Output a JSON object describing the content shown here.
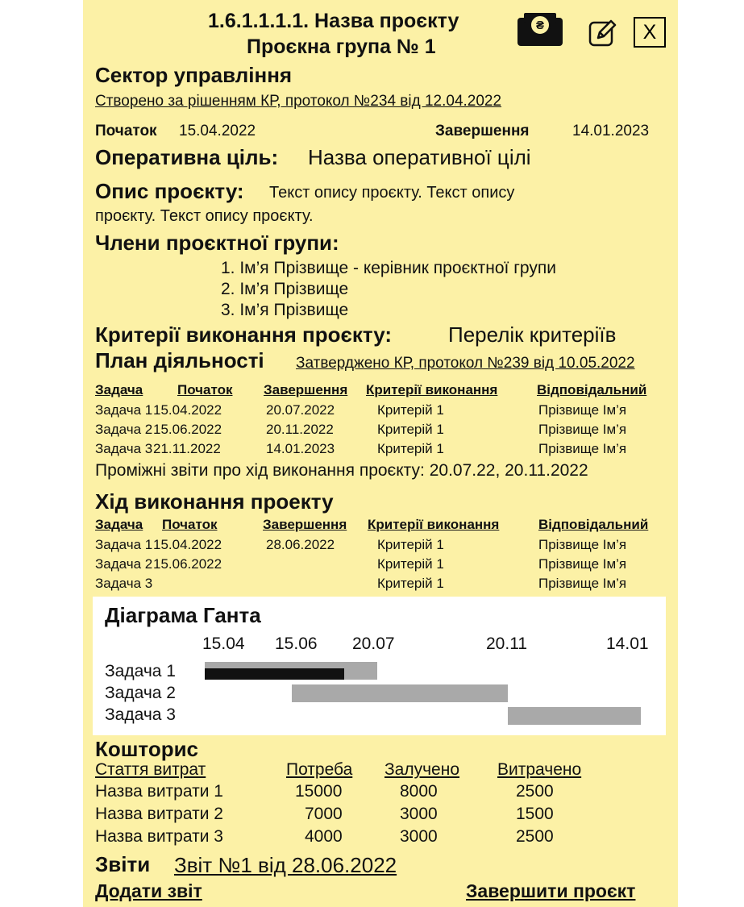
{
  "header": {
    "title": "1.6.1.1.1.1. Назва проєкту",
    "group": "Проєкна група № 1"
  },
  "sector": "Сектор управління",
  "created_note": "Створено за рішенням КР, протокол №234 від 12.04.2022",
  "dates": {
    "start_label": "Початок",
    "start_value": "15.04.2022",
    "end_label": "Завершення",
    "end_value": "14.01.2023"
  },
  "goal": {
    "label": "Оперативна ціль:",
    "value": "Назва оперативної цілі"
  },
  "description": {
    "label": "Опис проєкту:",
    "line1": "Текст опису проєкту. Текст опису",
    "line2": "проєкту. Текст опису проєкту."
  },
  "members": {
    "label": "Члени проєктної групи:",
    "items": [
      "1. Ім’я Прізвище - керівник проєктної групи",
      "2. Ім’я Прізвище",
      "3. Ім’я Прізвище"
    ]
  },
  "criteria": {
    "label": "Критерії виконання проєкту:",
    "value": "Перелік критеріїв"
  },
  "plan": {
    "label": "План діяльності",
    "approval": "Затверджено КР, протокол №239 від 10.05.2022",
    "headers": [
      "Задача",
      "Початок",
      "Завершення",
      "Критерії виконання",
      "Відповідальний"
    ],
    "rows": [
      [
        "Задача 1",
        "15.04.2022",
        "20.07.2022",
        "Критерій 1",
        "Прізвище Ім’я"
      ],
      [
        "Задача 2",
        "15.06.2022",
        "20.11.2022",
        "Критерій 1",
        "Прізвище Ім’я"
      ],
      [
        "Задача 3",
        "21.11.2022",
        "14.01.2023",
        "Критерій 1",
        "Прізвище Ім’я"
      ]
    ],
    "interim_reports": "Проміжні звіти про хід виконання проєкту: 20.07.22, 20.11.2022"
  },
  "progress": {
    "label": "Хід виконання проекту",
    "headers": [
      "Задача",
      "Початок",
      "Завершення",
      "Критерії виконання",
      "Відповідальний"
    ],
    "rows": [
      [
        "Задача 1",
        "15.04.2022",
        "28.06.2022",
        "Критерій 1",
        "Прізвище Ім’я"
      ],
      [
        "Задача 2",
        "15.06.2022",
        "",
        "Критерій 1",
        "Прізвище Ім’я"
      ],
      [
        "Задача 3",
        "",
        "",
        "Критерій 1",
        "Прізвище Ім’я"
      ]
    ]
  },
  "gantt": {
    "title": "Діаграма Ганта",
    "dates": [
      "15.04",
      "15.06",
      "20.07",
      "20.11",
      "14.01"
    ],
    "tasks": [
      "Задача 1",
      "Задача 2",
      "Задача 3"
    ],
    "colors": {
      "planned": "#a9a9a9",
      "actual": "#111111"
    }
  },
  "budget": {
    "label": "Кошторис",
    "headers": [
      "Стаття витрат",
      "Потреба",
      "Залучено",
      "Витрачено"
    ],
    "rows": [
      [
        "Назва витрати 1",
        "15000",
        "8000",
        "2500"
      ],
      [
        "Назва витрати 2",
        "7000",
        "3000",
        "1500"
      ],
      [
        "Назва витрати 3",
        "4000",
        "3000",
        "2500"
      ]
    ]
  },
  "reports": {
    "label": "Звіти",
    "link": "Звіт №1 від 28.06.2022"
  },
  "actions": {
    "add_report": "Додати звіт",
    "finish_project": "Завершити проєкт"
  },
  "icons": {
    "money": "money-wallet-icon",
    "edit": "pencil-edit-icon",
    "close_label": "X"
  },
  "colors": {
    "background": "#fcf1a6"
  }
}
